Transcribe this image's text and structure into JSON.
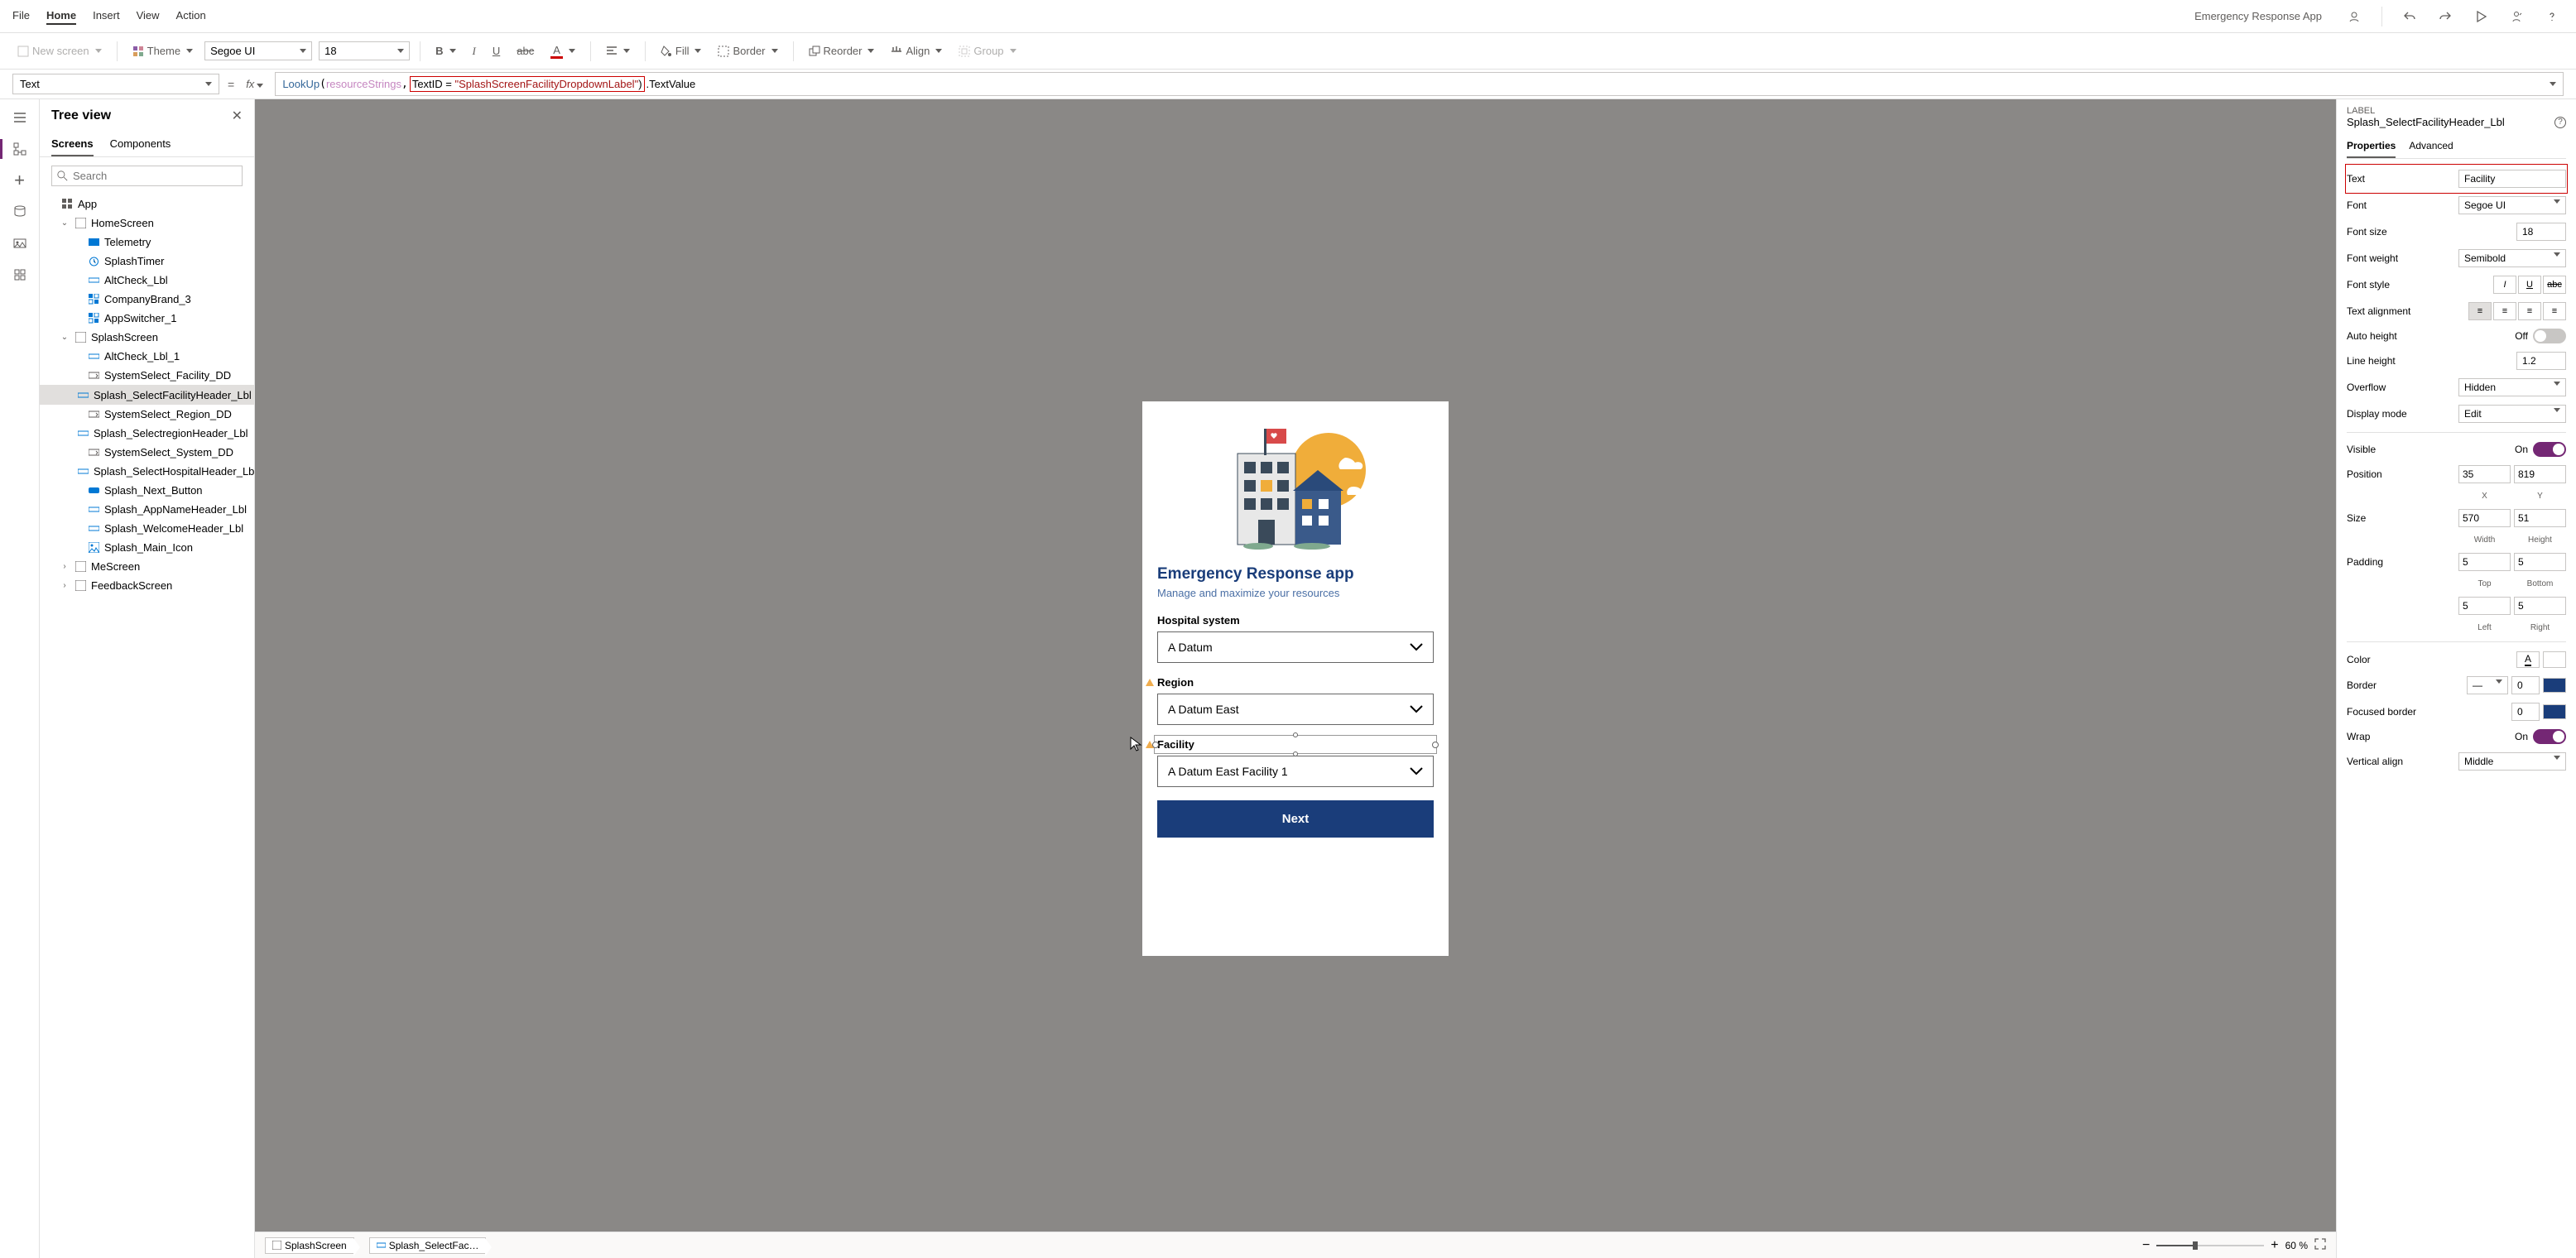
{
  "app": {
    "title": "Emergency Response App"
  },
  "menu": {
    "file": "File",
    "home": "Home",
    "insert": "Insert",
    "view": "View",
    "action": "Action"
  },
  "toolbar": {
    "new_screen": "New screen",
    "theme": "Theme",
    "font_family": "Segoe UI",
    "font_size": "18",
    "fill": "Fill",
    "border": "Border",
    "reorder": "Reorder",
    "align": "Align",
    "group": "Group"
  },
  "formula": {
    "property": "Text",
    "fx": "fx",
    "expr_fn": "LookUp",
    "expr_var": "resourceStrings",
    "expr_mid": "TextID = ",
    "expr_str": "\"SplashScreenFacilityDropdownLabel\"",
    "expr_tail": ".TextValue"
  },
  "tree": {
    "title": "Tree view",
    "tab_screens": "Screens",
    "tab_components": "Components",
    "search_ph": "Search",
    "items": [
      {
        "label": "App",
        "icon": "app",
        "indent": 0,
        "chev": ""
      },
      {
        "label": "HomeScreen",
        "icon": "screen",
        "indent": 1,
        "chev": "v"
      },
      {
        "label": "Telemetry",
        "icon": "tele",
        "indent": 2,
        "chev": ""
      },
      {
        "label": "SplashTimer",
        "icon": "timer",
        "indent": 2,
        "chev": ""
      },
      {
        "label": "AltCheck_Lbl",
        "icon": "label",
        "indent": 2,
        "chev": ""
      },
      {
        "label": "CompanyBrand_3",
        "icon": "comp",
        "indent": 2,
        "chev": ""
      },
      {
        "label": "AppSwitcher_1",
        "icon": "comp",
        "indent": 2,
        "chev": ""
      },
      {
        "label": "SplashScreen",
        "icon": "screen",
        "indent": 1,
        "chev": "v"
      },
      {
        "label": "AltCheck_Lbl_1",
        "icon": "label",
        "indent": 2,
        "chev": ""
      },
      {
        "label": "SystemSelect_Facility_DD",
        "icon": "dd",
        "indent": 2,
        "chev": ""
      },
      {
        "label": "Splash_SelectFacilityHeader_Lbl",
        "icon": "label",
        "indent": 2,
        "chev": "",
        "selected": true
      },
      {
        "label": "SystemSelect_Region_DD",
        "icon": "dd",
        "indent": 2,
        "chev": ""
      },
      {
        "label": "Splash_SelectregionHeader_Lbl",
        "icon": "label",
        "indent": 2,
        "chev": ""
      },
      {
        "label": "SystemSelect_System_DD",
        "icon": "dd",
        "indent": 2,
        "chev": ""
      },
      {
        "label": "Splash_SelectHospitalHeader_Lbl",
        "icon": "label",
        "indent": 2,
        "chev": ""
      },
      {
        "label": "Splash_Next_Button",
        "icon": "btn",
        "indent": 2,
        "chev": ""
      },
      {
        "label": "Splash_AppNameHeader_Lbl",
        "icon": "label",
        "indent": 2,
        "chev": ""
      },
      {
        "label": "Splash_WelcomeHeader_Lbl",
        "icon": "label",
        "indent": 2,
        "chev": ""
      },
      {
        "label": "Splash_Main_Icon",
        "icon": "img",
        "indent": 2,
        "chev": ""
      },
      {
        "label": "MeScreen",
        "icon": "screen",
        "indent": 1,
        "chev": ">"
      },
      {
        "label": "FeedbackScreen",
        "icon": "screen",
        "indent": 1,
        "chev": ">"
      }
    ]
  },
  "phone": {
    "heading": "Emergency Response app",
    "sub": "Manage and maximize your resources",
    "hospital_label": "Hospital system",
    "hospital_value": "A Datum",
    "region_label": "Region",
    "region_value": "A Datum East",
    "facility_label": "Facility",
    "facility_value": "A Datum East Facility 1",
    "next": "Next"
  },
  "breadcrumb": {
    "bc1": "SplashScreen",
    "bc2": "Splash_SelectFac…"
  },
  "zoom": {
    "pct": "60",
    "unit": "%"
  },
  "props": {
    "kind": "LABEL",
    "name": "Splash_SelectFacilityHeader_Lbl",
    "tab_props": "Properties",
    "tab_adv": "Advanced",
    "text_label": "Text",
    "text_value": "Facility",
    "font_label": "Font",
    "font_value": "Segoe UI",
    "fontsize_label": "Font size",
    "fontsize_value": "18",
    "fontweight_label": "Font weight",
    "fontweight_value": "Semibold",
    "fontstyle_label": "Font style",
    "textalign_label": "Text alignment",
    "autoheight_label": "Auto height",
    "autoheight_state": "Off",
    "lineheight_label": "Line height",
    "lineheight_value": "1.2",
    "overflow_label": "Overflow",
    "overflow_value": "Hidden",
    "displaymode_label": "Display mode",
    "displaymode_value": "Edit",
    "visible_label": "Visible",
    "visible_state": "On",
    "position_label": "Position",
    "pos_x": "35",
    "pos_y": "819",
    "pos_xl": "X",
    "pos_yl": "Y",
    "size_label": "Size",
    "size_w": "570",
    "size_h": "51",
    "size_wl": "Width",
    "size_hl": "Height",
    "padding_label": "Padding",
    "pad_t": "5",
    "pad_b": "5",
    "pad_tl": "Top",
    "pad_bl": "Bottom",
    "pad_l": "5",
    "pad_r": "5",
    "pad_ll": "Left",
    "pad_rl": "Right",
    "color_label": "Color",
    "border_label": "Border",
    "border_val": "0",
    "border_color": "#1a3d7a",
    "focborder_label": "Focused border",
    "focborder_val": "0",
    "wrap_label": "Wrap",
    "wrap_state": "On",
    "valign_label": "Vertical align",
    "valign_value": "Middle"
  }
}
